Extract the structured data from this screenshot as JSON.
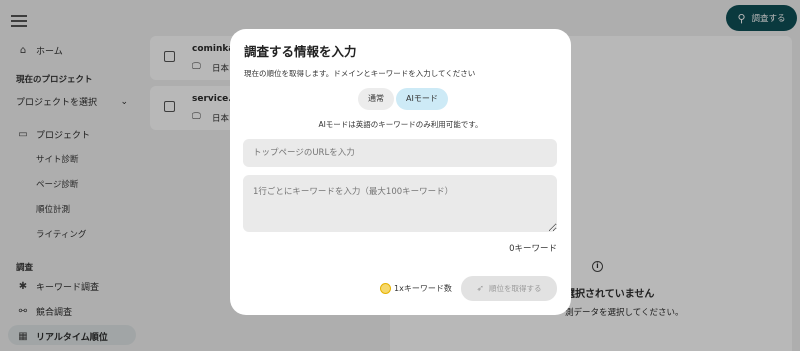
{
  "header": {
    "search_button": "調査する"
  },
  "sidebar": {
    "home": "ホーム",
    "current_project_label": "現在のプロジェクト",
    "project_select": "プロジェクトを選択",
    "projects": "プロジェクト",
    "sub": [
      "サイト診断",
      "ページ診断",
      "順位計測",
      "ライティング"
    ],
    "research_label": "調査",
    "keyword_research": "キーワード調査",
    "competitor_research": "競合調査",
    "realtime_rank": "リアルタイム順位"
  },
  "cards": [
    {
      "title": "cominka",
      "lang": "日本"
    },
    {
      "title": "service.c",
      "lang": "日本"
    }
  ],
  "right_panel": {
    "empty_title": "選択されていません",
    "empty_desc": "測データを選択してください。"
  },
  "modal": {
    "title": "調査する情報を入力",
    "description": "現在の順位を取得します。ドメインとキーワードを入力してください",
    "mode_normal": "通常",
    "mode_ai": "AIモード",
    "ai_note": "AIモードは英語のキーワードのみ利用可能です。",
    "url_placeholder": "トップページのURLを入力",
    "keywords_placeholder": "1行ごとにキーワードを入力（最大100キーワード）",
    "keyword_count": "0キーワード",
    "usage": "1xキーワード数",
    "submit": "順位を取得する"
  },
  "colors": {
    "accent": "#0f4f57",
    "ai_mode": "#cdeaf6"
  }
}
